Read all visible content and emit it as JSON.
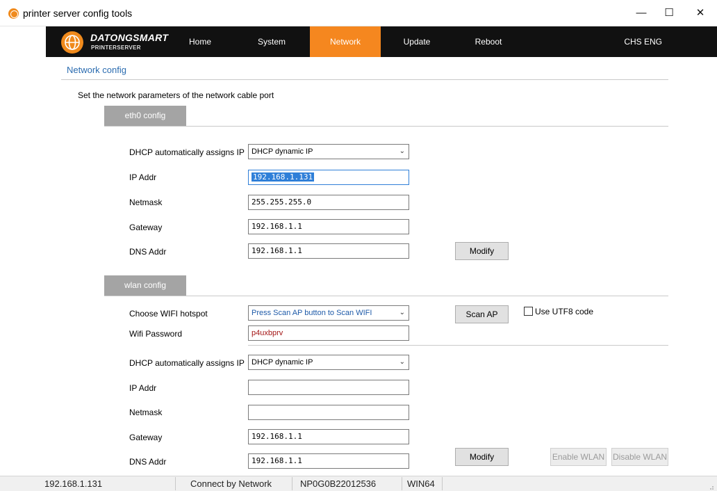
{
  "window": {
    "title": "printer server config tools",
    "minimize": "—",
    "maximize": "☐",
    "close": "✕"
  },
  "logo": {
    "brand": "DATONGSMART",
    "sub": "PRINTERSERVER"
  },
  "nav": {
    "home": "Home",
    "system": "System",
    "network": "Network",
    "update": "Update",
    "reboot": "Reboot",
    "chs": "CHS",
    "eng": "ENG",
    "active": "Network"
  },
  "page": {
    "title": "Network config",
    "description": "Set the network parameters of the network cable port"
  },
  "eth0": {
    "tab": "eth0 config",
    "dhcp_label": "DHCP automatically assigns IP",
    "dhcp_value": "DHCP dynamic IP",
    "ip_label": "IP Addr",
    "ip_value": "192.168.1.131",
    "netmask_label": "Netmask",
    "netmask_value": "255.255.255.0",
    "gateway_label": "Gateway",
    "gateway_value": "192.168.1.1",
    "dns_label": "DNS Addr",
    "dns_value": "192.168.1.1",
    "modify": "Modify"
  },
  "wlan": {
    "tab": "wlan config",
    "hotspot_label": "Choose WIFI hotspot",
    "hotspot_value": "Press Scan AP button to Scan WIFI",
    "scan": "Scan AP",
    "utf8": "Use UTF8 code",
    "password_label": "Wifi Password",
    "password_value": "p4uxbprv",
    "dhcp_label": "DHCP automatically assigns IP",
    "dhcp_value": "DHCP dynamic IP",
    "ip_label": "IP Addr",
    "ip_value": "",
    "netmask_label": "Netmask",
    "netmask_value": "",
    "gateway_label": "Gateway",
    "gateway_value": "192.168.1.1",
    "dns_label": "DNS Addr",
    "dns_value": "192.168.1.1",
    "modify": "Modify",
    "enable": "Enable WLAN",
    "disable": "Disable WLAN"
  },
  "status": {
    "ip": "192.168.1.131",
    "connection": "Connect by Network",
    "serial": "NP0G0B22012536",
    "platform": "WIN64"
  },
  "colors": {
    "accent": "#f5871f",
    "navbar": "#111111",
    "title_blue": "#2b6cb0",
    "tab_gray": "#a4a4a4"
  }
}
